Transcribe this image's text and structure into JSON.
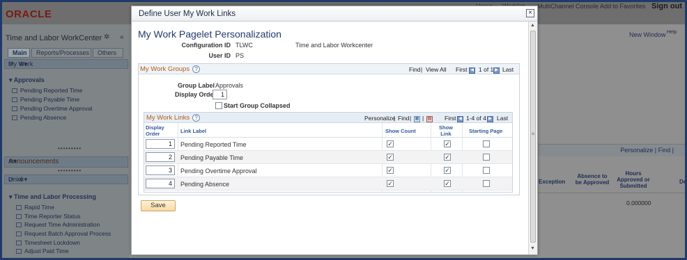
{
  "background": {
    "logo": "ORACLE",
    "top_links": [
      "Home",
      "Worklist",
      "MultiChannel Console",
      "Add to Favorites"
    ],
    "sign_out": "Sign out",
    "workcenter_title": "Time and Labor WorkCenter",
    "tabs": [
      "Main",
      "Reports/Processes",
      "Others"
    ],
    "my_work": {
      "header": "My Work",
      "group": "Approvals",
      "items": [
        "Pending Reported Time",
        "Pending Payable Time",
        "Pending Overtime Approval",
        "Pending Absence"
      ]
    },
    "announcements": {
      "header": "Announcements"
    },
    "links": {
      "header": "Links",
      "group": "Time and Labor Processing",
      "items": [
        "Rapid Time",
        "Time Reporter Status",
        "Request Time Administration",
        "Request Batch Approval Process",
        "Timesheet Lockdown",
        "Adjust Paid Time"
      ]
    },
    "right": {
      "new_window": "New Window",
      "help": "Help",
      "personalize_find": "Personalize | Find |",
      "col_exception": "Exception",
      "col_absence": "Absence to be Approved",
      "col_hours": "Hours Approved or Submitted",
      "col_de": "De",
      "hours_value": "0.000000"
    }
  },
  "modal": {
    "title": "Define User My Work Links",
    "close_symbol": "×",
    "heading": "My Work Pagelet Personalization",
    "config_id_label": "Configuration ID",
    "config_id_value": "TLWC",
    "config_desc": "Time and Labor Workcenter",
    "user_id_label": "User ID",
    "user_id_value": "PS",
    "my_work_groups": {
      "title": "My Work Groups",
      "find": "Find",
      "view_all": "View All",
      "first": "First",
      "range": "1 of 1",
      "last": "Last",
      "group_label_label": "Group Label",
      "group_label_value": "Approvals",
      "display_order_label": "Display Order",
      "display_order_value": "1",
      "start_collapsed_label": "Start Group Collapsed",
      "start_collapsed_checked": false
    },
    "my_work_links": {
      "title": "My Work Links",
      "personalize": "Personalize",
      "find": "Find",
      "first": "First",
      "range": "1-4 of 4",
      "last": "Last",
      "columns": {
        "display_order": "Display Order",
        "link_label": "Link Label",
        "show_count": "Show Count",
        "show_link": "Show Link",
        "starting_page": "Starting Page"
      },
      "rows": [
        {
          "order": "1",
          "label": "Pending Reported Time",
          "show_count": true,
          "show_link": true,
          "starting_page": false
        },
        {
          "order": "2",
          "label": "Pending Payable Time",
          "show_count": true,
          "show_link": true,
          "starting_page": false
        },
        {
          "order": "3",
          "label": "Pending Overtime Approval",
          "show_count": true,
          "show_link": true,
          "starting_page": false
        },
        {
          "order": "4",
          "label": "Pending Absence",
          "show_count": true,
          "show_link": true,
          "starting_page": false
        }
      ]
    },
    "save_label": "Save"
  },
  "colors": {
    "accent_orange": "#b05e1a",
    "link_blue": "#1f4a8a",
    "heading_blue": "#203a6b",
    "save_button": "#f9d9a0"
  },
  "icons": [
    "settings-icon",
    "collapse-icon",
    "refresh-icon",
    "options-menu-icon",
    "help-icon",
    "close-icon",
    "first-arrow-icon",
    "last-arrow-icon",
    "view-icon",
    "download-icon",
    "scroll-up-icon",
    "scroll-down-icon"
  ]
}
